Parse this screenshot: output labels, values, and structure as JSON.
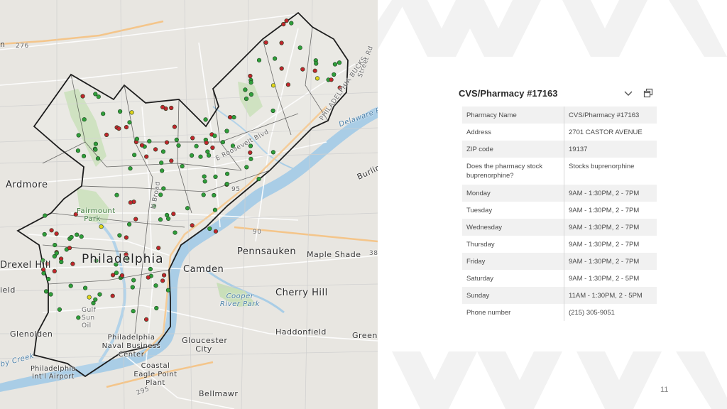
{
  "map": {
    "labels": {
      "ardmore": "Ardmore",
      "fairmount_park": "Fairmount Park",
      "philadelphia": "Philadelphia",
      "pennsauken": "Pennsauken",
      "maple_shade": "Maple Shade",
      "camden": "Camden",
      "cherry_hill": "Cherry Hill",
      "cooper_river_park": "Cooper River Park",
      "drexel_hill": "Drexel Hill",
      "haddonfield": "Haddonfield",
      "glenolden": "Glenolden",
      "gloucester_city": "Gloucester City",
      "navy_yard": "Philadelphia Naval Business Center",
      "airport": "Philadelphia Int'l Airport",
      "eagle_point": "Coastal Eagle Point Plant",
      "bellmawr": "Bellmawr",
      "green": "Green",
      "burlington": "Burlin",
      "field": "ield",
      "delaware_river": "Delaware R",
      "darby_creek": "by Creek",
      "philadelphia_bucks": "PHILADELPHIA BUCKS",
      "street_rd": "Street Rd",
      "roosevelt_blvd": "E Roosevelt Blvd",
      "route_276": "276",
      "route_95": "95",
      "route_90": "90",
      "route_295": "295",
      "route_38": "38",
      "n_broad": "N Broad",
      "gulf_oil": "Gulf Sun Oil",
      "n": "n"
    },
    "pin_colors": {
      "green": "#2f9e3a",
      "red": "#c0262d",
      "yellow": "#e0d21a"
    }
  },
  "popup": {
    "title": "CVS/Pharmacy #17163",
    "collapse_icon": "chevron-down-icon",
    "dock_icon": "dock-icon",
    "rows": [
      {
        "field": "Pharmacy Name",
        "value": "CVS/Pharmacy #17163"
      },
      {
        "field": "Address",
        "value": "2701 CASTOR AVENUE"
      },
      {
        "field": "ZIP code",
        "value": "19137"
      },
      {
        "field": "Does the pharmacy stock buprenorphine?",
        "value": "Stocks buprenorphine"
      },
      {
        "field": "Monday",
        "value": "9AM - 1:30PM, 2 - 7PM"
      },
      {
        "field": "Tuesday",
        "value": "9AM - 1:30PM, 2 - 7PM"
      },
      {
        "field": "Wednesday",
        "value": "9AM - 1:30PM, 2 - 7PM"
      },
      {
        "field": "Thursday",
        "value": "9AM - 1:30PM, 2 - 7PM"
      },
      {
        "field": "Friday",
        "value": "9AM - 1:30PM, 2 - 7PM"
      },
      {
        "field": "Saturday",
        "value": "9AM - 1:30PM, 2 - 5PM"
      },
      {
        "field": "Sunday",
        "value": "11AM - 1:30PM, 2 - 5PM"
      },
      {
        "field": "Phone number",
        "value": "(215) 305-9051"
      }
    ]
  },
  "slide": {
    "page_number": "11"
  }
}
